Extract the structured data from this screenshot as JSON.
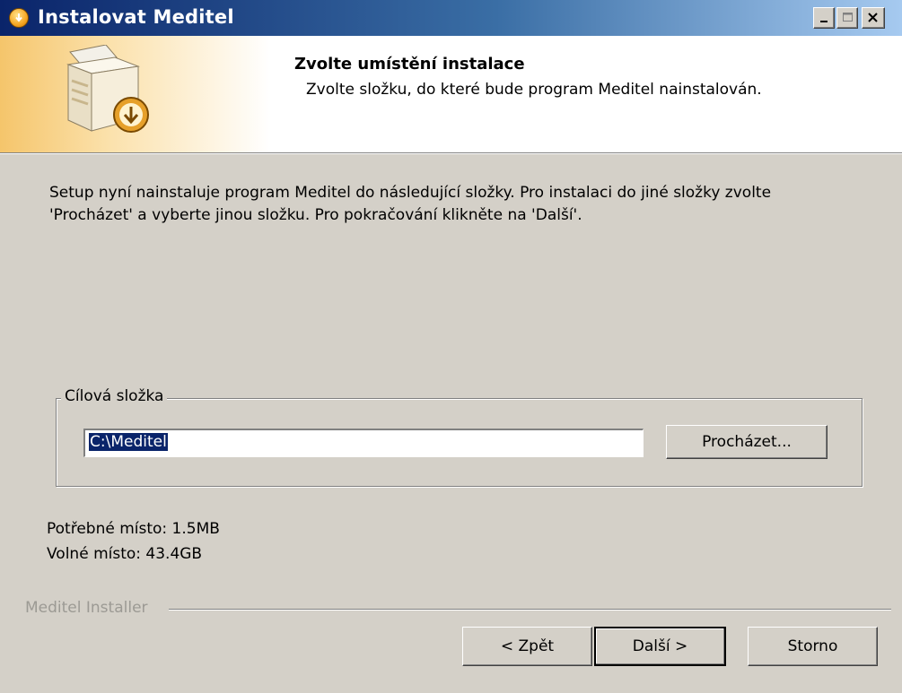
{
  "window": {
    "title": "Instalovat Meditel"
  },
  "header": {
    "title": "Zvolte umístění instalace",
    "subtitle": "Zvolte složku, do které bude program Meditel nainstalován."
  },
  "body": {
    "intro_line1": "Setup nyní nainstaluje program Meditel do následující složky. Pro instalaci do jiné složky zvolte",
    "intro_line2": "'Procházet' a vyberte jinou složku. Pro pokračování klikněte na 'Další'.",
    "destination_group_label": "Cílová složka",
    "destination_path": "C:\\Meditel",
    "browse_label": "Procházet...",
    "space_required": "Potřebné místo: 1.5MB",
    "space_available": "Volné místo: 43.4GB"
  },
  "footer": {
    "brand": "Meditel Installer",
    "back_label": "< Zpět",
    "next_label": "Další >",
    "cancel_label": "Storno"
  },
  "colors": {
    "titlebar_start": "#0a246a",
    "titlebar_end": "#a6caf0",
    "dialog_bg": "#d4d0c8",
    "selection": "#0a246a"
  },
  "icons": {
    "title": "installer-icon",
    "header": "setup-box-icon"
  }
}
